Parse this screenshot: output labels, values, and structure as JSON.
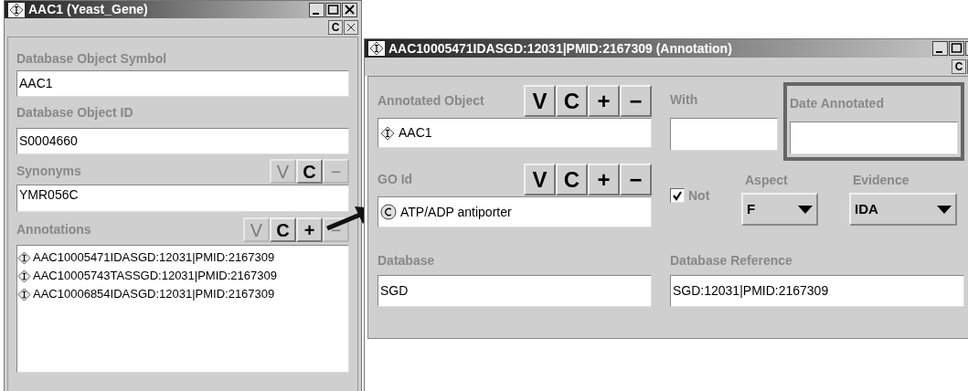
{
  "gene_window": {
    "title": "AAC1 (Yeast_Gene)",
    "copy_button": "C",
    "symbol": {
      "label": "Database Object Symbol",
      "value": "AAC1"
    },
    "object_id": {
      "label": "Database Object ID",
      "value": "S0004660"
    },
    "synonyms": {
      "label": "Synonyms",
      "value": "YMR056C",
      "buttons": [
        {
          "label": "V",
          "disabled": true
        },
        {
          "label": "C",
          "disabled": false
        },
        {
          "label": "−",
          "disabled": true
        }
      ]
    },
    "annotations": {
      "label": "Annotations",
      "buttons": [
        {
          "label": "V",
          "disabled": true
        },
        {
          "label": "C",
          "disabled": false
        },
        {
          "label": "+",
          "disabled": false
        },
        {
          "label": "−",
          "disabled": true
        }
      ],
      "items": [
        "AAC10005471IDASGD:12031|PMID:2167309",
        "AAC10005743TASSGD:12031|PMID:2167309",
        "AAC10006854IDASGD:12031|PMID:2167309"
      ]
    }
  },
  "annotation_window": {
    "title": "AAC10005471IDASGD:12031|PMID:2167309 (Annotation)",
    "copy_button": "C",
    "annotated_object": {
      "label": "Annotated Object",
      "value": "AAC1",
      "buttons": [
        {
          "label": "V",
          "disabled": false
        },
        {
          "label": "C",
          "disabled": false
        },
        {
          "label": "+",
          "disabled": false
        },
        {
          "label": "−",
          "disabled": false
        }
      ]
    },
    "with": {
      "label": "With"
    },
    "date_annotated": {
      "label": "Date Annotated",
      "focused": true
    },
    "go_id": {
      "label": "GO Id",
      "value": "ATP/ADP antiporter",
      "buttons": [
        {
          "label": "V",
          "disabled": false
        },
        {
          "label": "C",
          "disabled": false
        },
        {
          "label": "+",
          "disabled": false
        },
        {
          "label": "−",
          "disabled": false
        }
      ]
    },
    "not": {
      "label": "Not",
      "checked": true
    },
    "aspect": {
      "label": "Aspect",
      "value": "F"
    },
    "evidence": {
      "label": "Evidence",
      "value": "IDA"
    },
    "database": {
      "label": "Database",
      "value": "SGD"
    },
    "database_reference": {
      "label": "Database Reference",
      "value": "SGD:12031|PMID:2167309"
    }
  }
}
